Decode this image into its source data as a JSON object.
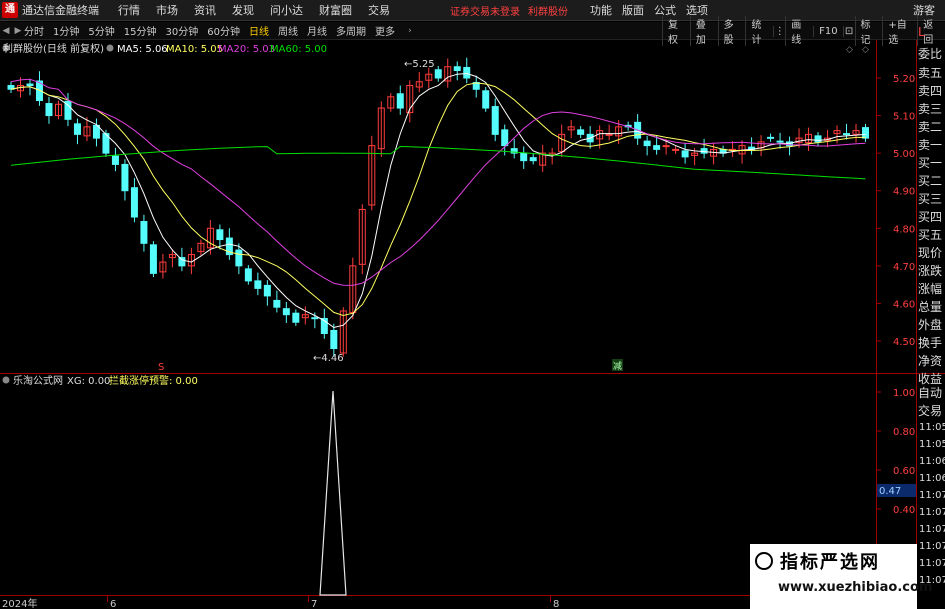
{
  "app": {
    "title": "通达信金融终端",
    "logo": "通",
    "account_status": "证券交易未登录",
    "stock_name": "利群股份",
    "guest": "游客"
  },
  "menu": {
    "left": [
      "行情",
      "市场",
      "资讯",
      "发现",
      "问小达",
      "财富圈",
      "交易"
    ],
    "right": [
      "功能",
      "版面",
      "公式",
      "选项"
    ]
  },
  "toolbar": {
    "periods": [
      "分时",
      "1分钟",
      "5分钟",
      "15分钟",
      "30分钟",
      "60分钟",
      "日线",
      "周线",
      "月线",
      "多周期",
      "更多"
    ],
    "active_period": "日线",
    "right": [
      "复权",
      "叠加",
      "多股",
      "统计",
      "画线",
      "F10",
      "标记",
      "+自选",
      "返回"
    ]
  },
  "main_chart": {
    "stock_label": "利群股份(日线 前复权)",
    "indicators": [
      {
        "name": "MA5",
        "value": "5.06",
        "color": "#ffffff"
      },
      {
        "name": "MA10",
        "value": "5.05",
        "color": "#ffff60"
      },
      {
        "name": "MA20",
        "value": "5.03",
        "color": "#e040e0"
      },
      {
        "name": "MA60",
        "value": "5.00",
        "color": "#00e000"
      }
    ],
    "y_ticks": [
      "5.20",
      "5.10",
      "5.00",
      "4.90",
      "4.80",
      "4.70",
      "4.60",
      "4.50"
    ],
    "high_label": "5.25",
    "low_label": "4.46",
    "marker_s": "S",
    "marker_jian": "减",
    "colors": {
      "up": "#ff3c3c",
      "down": "#54fcfc",
      "axis": "#a00000"
    }
  },
  "sub_chart": {
    "label": "乐淘公式网",
    "xg": "XG: 0.00",
    "alert": "拦截涨停预警: 0.00",
    "y_ticks": [
      "1.00",
      "0.80",
      "0.60",
      "0.40"
    ],
    "cursor_value": "0.47"
  },
  "x_axis": [
    "2024年",
    "6",
    "7",
    "8"
  ],
  "side_panel": {
    "title": "L",
    "items": [
      "委比",
      "卖五",
      "卖四",
      "卖三",
      "卖二",
      "卖一",
      "买一",
      "买二",
      "买三",
      "买四",
      "买五",
      "现价",
      "涨跌",
      "涨幅",
      "总量",
      "外盘",
      "换手",
      "净资",
      "收益"
    ],
    "lower_items": [
      "自动",
      "交易"
    ],
    "times": [
      "11:05",
      "11:05",
      "11:06",
      "11:06",
      "11:07",
      "11:07",
      "11:07",
      "11:07",
      "11:07",
      "11:07"
    ]
  },
  "watermark": {
    "main": "指标严选网",
    "sub": "www.xuezhibiao.com"
  }
}
